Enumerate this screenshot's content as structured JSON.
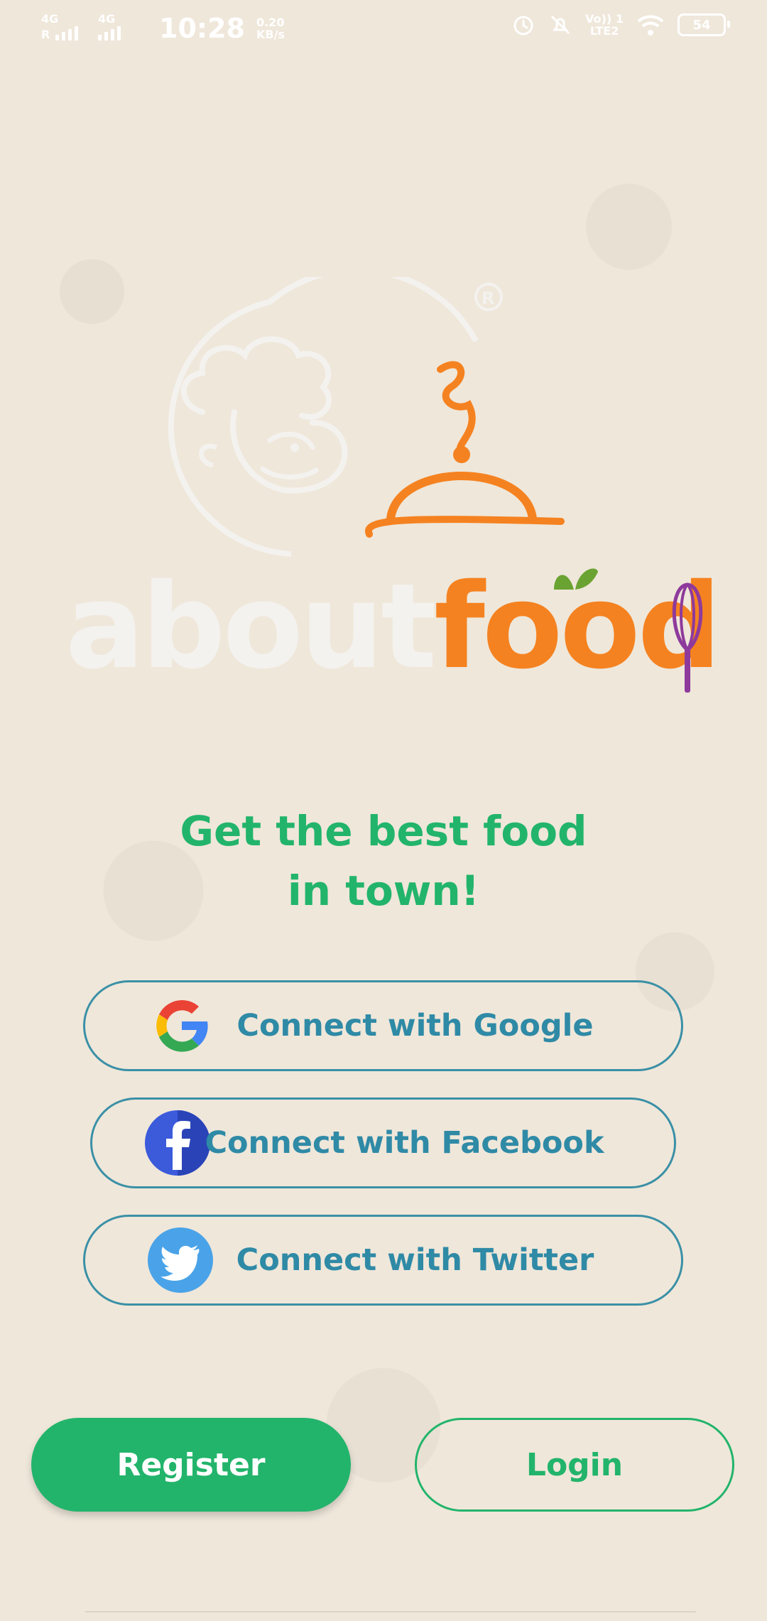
{
  "status_bar": {
    "network1": "4G",
    "network2": "4G",
    "roaming": "R",
    "time": "10:28",
    "speed_value": "0.20",
    "speed_unit": "KB/s",
    "volte_line1": "Vo)) 1",
    "volte_line2": "LTE2",
    "battery": "54"
  },
  "logo": {
    "text_about": "about",
    "text_food": "food",
    "registered": "®"
  },
  "tagline": {
    "line1": "Get the best food",
    "line2": "in town!"
  },
  "social": {
    "google": "Connect with Google",
    "facebook": "Connect with Facebook",
    "twitter": "Connect with Twitter"
  },
  "actions": {
    "register": "Register",
    "login": "Login"
  },
  "colors": {
    "background": "#efe7da",
    "green": "#22b46b",
    "teal": "#3a90a6",
    "orange": "#f58220",
    "purple": "#8e3a9c"
  },
  "icons": [
    "google-icon",
    "facebook-icon",
    "twitter-icon",
    "alarm-icon",
    "mute-icon",
    "wifi-icon",
    "chef-logo-icon",
    "cloche-icon",
    "whisk-icon"
  ]
}
